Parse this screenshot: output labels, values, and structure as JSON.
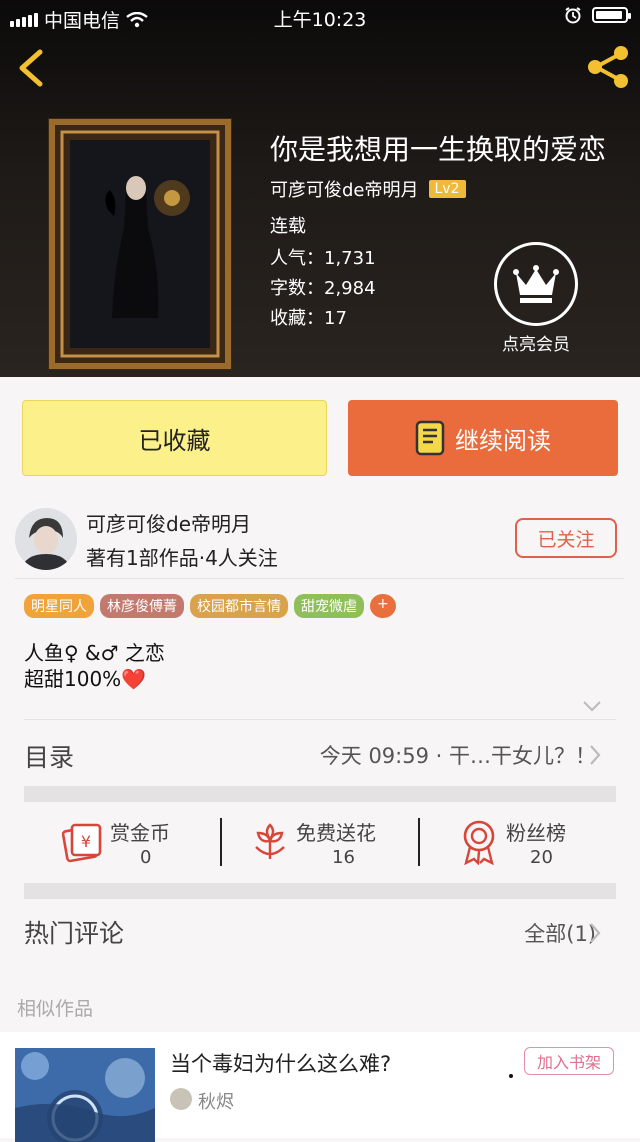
{
  "status_bar": {
    "carrier": "中国电信",
    "time": "上午10:23"
  },
  "book": {
    "title": "你是我想用一生换取的爱恋",
    "author": "可彦可俊de帝明月",
    "level": "Lv2",
    "status": "连载",
    "popularity": "人气：1,731",
    "word_count": "字数：2,984",
    "favorites": "收藏：17",
    "vip_label": "点亮会员"
  },
  "actions": {
    "favorited_label": "已收藏",
    "read_label": "继续阅读"
  },
  "author_card": {
    "name": "可彦可俊de帝明月",
    "info": "著有1部作品·4人关注",
    "follow_label": "已关注"
  },
  "tags": [
    {
      "label": "明星同人",
      "color": "#f0a33a"
    },
    {
      "label": "林彦俊傅菁",
      "color": "#c27a6e"
    },
    {
      "label": "校园都市言情",
      "color": "#d9a24c"
    },
    {
      "label": "甜宠微虐",
      "color": "#8fbf5a"
    },
    {
      "label": "+",
      "color": "#e8703c"
    }
  ],
  "description": {
    "line1": "人鱼♀ &♂ 之恋",
    "line2": "超甜100%❤️"
  },
  "toc": {
    "title": "目录",
    "latest": "今天 09:59 · 干…干女儿？！"
  },
  "stats": [
    {
      "label": "赏金币",
      "value": "0"
    },
    {
      "label": "免费送花",
      "value": "16"
    },
    {
      "label": "粉丝榜",
      "value": "20"
    }
  ],
  "comments": {
    "title": "热门评论",
    "all_label": "全部(1)"
  },
  "similar": {
    "title": "相似作品",
    "item": {
      "title": "当个毒妇为什么这么难?",
      "author": "秋烬",
      "add_label": "加入书架"
    }
  },
  "colors": {
    "accent_orange": "#ea6b3c",
    "fav_yellow": "#fbf08a",
    "follow_red": "#e0614a",
    "icon_red": "#d8463a"
  }
}
